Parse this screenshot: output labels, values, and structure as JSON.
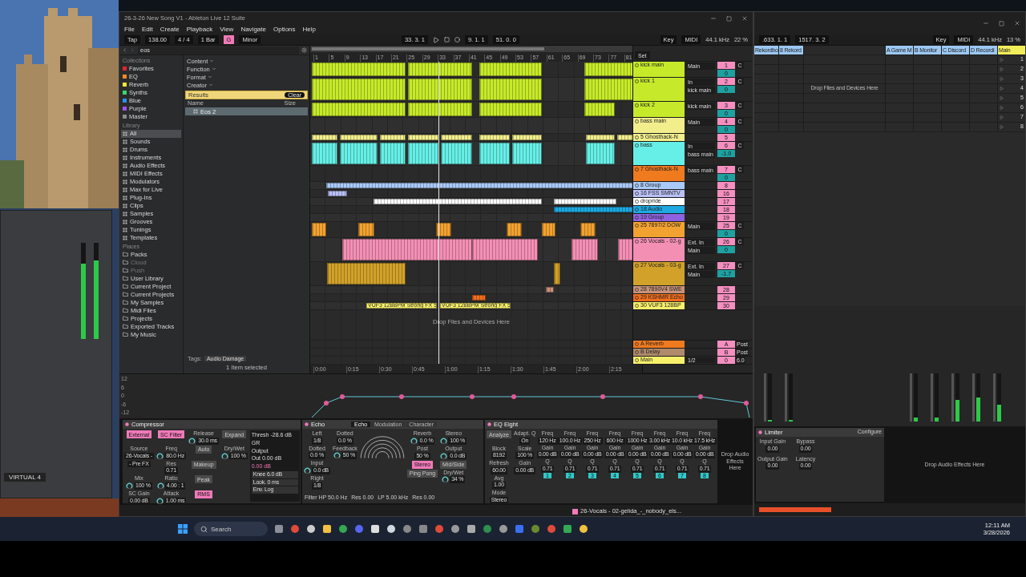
{
  "desktop": {
    "plugin_label": "VIRTUAL 4",
    "meters": [
      {
        "level": 0.78
      },
      {
        "level": 0.82
      }
    ]
  },
  "main_window": {
    "title": "26-3-26 New Song V1 - Ableton Live 12 Suite",
    "menu": [
      "File",
      "Edit",
      "Create",
      "Playback",
      "View",
      "Navigate",
      "Options",
      "Help"
    ],
    "control_bar": {
      "tap": "Tap",
      "tempo": "138.00",
      "signature": "4 / 4",
      "quantize": "1 Bar",
      "key": "G",
      "scale": "Minor",
      "position": "33. 3. 1",
      "loop_start": "9. 1. 1",
      "loop_length": "51. 0. 0",
      "key_button": "Key",
      "midi_button": "MIDI",
      "sample_rate": "44.1 kHz",
      "cpu": "22 %"
    },
    "browser": {
      "search": "eos",
      "collections_title": "Collections",
      "collections": [
        {
          "label": "Favorites",
          "color": "#e0252b"
        },
        {
          "label": "EQ",
          "color": "#f08a24"
        },
        {
          "label": "Reverb",
          "color": "#f2e634"
        },
        {
          "label": "Synths",
          "color": "#3ad66a"
        },
        {
          "label": "Blue",
          "color": "#2f8fe8"
        },
        {
          "label": "Purple",
          "color": "#a152e8"
        },
        {
          "label": "Master",
          "color": "#8a8a8a"
        }
      ],
      "library_title": "Library",
      "library": [
        {
          "label": "All",
          "selected": true
        },
        {
          "label": "Sounds",
          "selected": false
        },
        {
          "label": "Drums",
          "selected": false
        },
        {
          "label": "Instruments",
          "selected": false
        },
        {
          "label": "Audio Effects",
          "selected": false
        },
        {
          "label": "MIDI Effects",
          "selected": false
        },
        {
          "label": "Modulators",
          "selected": false
        },
        {
          "label": "Max for Live",
          "selected": false
        },
        {
          "label": "Plug-Ins",
          "selected": false
        },
        {
          "label": "Clips",
          "selected": false
        },
        {
          "label": "Samples",
          "selected": false
        },
        {
          "label": "Grooves",
          "selected": false
        },
        {
          "label": "Tunings",
          "selected": false
        },
        {
          "label": "Templates",
          "selected": false
        }
      ],
      "places_title": "Places",
      "places": [
        {
          "label": "Packs",
          "disabled": false
        },
        {
          "label": "Cloud",
          "disabled": true
        },
        {
          "label": "Push",
          "disabled": true
        },
        {
          "label": "User Library",
          "disabled": false
        },
        {
          "label": "Current Project",
          "disabled": false
        },
        {
          "label": "Current Projects",
          "disabled": false
        },
        {
          "label": "My Samples",
          "disabled": false
        },
        {
          "label": "Midi Files",
          "disabled": false
        },
        {
          "label": "Projects",
          "disabled": false
        },
        {
          "label": "Exported Tracks",
          "disabled": false
        },
        {
          "label": "My Music",
          "disabled": false
        }
      ],
      "filters": [
        "Content",
        "Function",
        "Format",
        "Creator"
      ],
      "results_label": "Results",
      "clear": "Clear",
      "columns": [
        "Name",
        "Size"
      ],
      "results": [
        {
          "name": "Eos 2",
          "selected": true
        }
      ],
      "tags_label": "Tags:",
      "tag": "Audio Damage",
      "status": "1 Item selected"
    },
    "arrangement": {
      "ruler": [
        "1",
        "5",
        "9",
        "13",
        "17",
        "21",
        "25",
        "29",
        "33",
        "37",
        "41",
        "45",
        "49",
        "53",
        "57",
        "61",
        "65",
        "69",
        "73",
        "77",
        "81"
      ],
      "set_button": "Set",
      "tracks": [
        {
          "number": "1",
          "name": "kick main",
          "color": "#c6ea2a",
          "expanded": true,
          "route": "Main",
          "volume": "0",
          "pan": "C"
        },
        {
          "number": "2",
          "name": "kick 1",
          "color": "#c6ea2a",
          "expanded": true,
          "input": "In",
          "route": "kick main",
          "volume": "0",
          "pan": "C"
        },
        {
          "number": "3",
          "name": "kick 2",
          "color": "#c6ea2a",
          "expanded": true,
          "route": "kick main",
          "volume": "0",
          "pan": "C"
        },
        {
          "number": "4",
          "name": "bass main",
          "color": "#f2ee8c",
          "expanded": true,
          "route": "Main",
          "volume": "0",
          "pan": "C"
        },
        {
          "number": "5",
          "name": "5 Ghosthack-N",
          "color": "#f2ee8c",
          "expanded": false
        },
        {
          "number": "6",
          "name": "bass",
          "color": "#66efe6",
          "expanded": true,
          "input": "In",
          "route": "bass main",
          "volume": "-1.0",
          "pan": "C"
        },
        {
          "number": "7",
          "name": "7 Ghosthack-N",
          "color": "#f07a1e",
          "expanded": true,
          "route": "bass main",
          "volume": "0",
          "pan": "C"
        },
        {
          "number": "8",
          "name": "8 Group",
          "color": "#a9c9f6",
          "expanded": false
        },
        {
          "number": "16",
          "name": "16 FSS  SMNTV",
          "color": "#b8bff5",
          "expanded": false
        },
        {
          "number": "17",
          "name": "dropride",
          "color": "#ffffff",
          "expanded": false
        },
        {
          "number": "18",
          "name": "18 Audio",
          "color": "#1ea9e1",
          "expanded": false
        },
        {
          "number": "19",
          "name": "19 Group",
          "color": "#8f62e0",
          "expanded": false
        },
        {
          "number": "25",
          "name": "25 7897/2 DOW",
          "color": "#f2a230",
          "expanded": true,
          "route": "Main",
          "volume": "0",
          "pan": "C"
        },
        {
          "number": "26",
          "name": "26 Vocals - 02-g",
          "color": "#f48fb4",
          "expanded": true,
          "input": "Ext. In",
          "route": "Main",
          "volume": "0",
          "pan": "C"
        },
        {
          "number": "27",
          "name": "27 Vocals - 03-g",
          "color": "#d1a12a",
          "expanded": true,
          "input": "Ext. In",
          "route": "Main",
          "volume": "-1.7",
          "pan": "C"
        },
        {
          "number": "28",
          "name": "28 7890V4 SWE",
          "color": "#c8927a",
          "expanded": false
        },
        {
          "number": "29",
          "name": "29 KSHMR Echo",
          "color": "#f06e1e",
          "expanded": false
        },
        {
          "number": "30",
          "name": "30 VUF3 128BP",
          "color": "#f7f06a",
          "expanded": false,
          "clip_labels": [
            "VUF3 128BPM Strong FX 5",
            "VUF3 128BPM Strong FX 5"
          ]
        }
      ],
      "drop_hint": "Drop Files and Devices Here",
      "returns": [
        {
          "number": "A",
          "name": "A Reverb",
          "color": "#f07a1e",
          "send": "Post"
        },
        {
          "number": "B",
          "name": "B Delay",
          "color": "#b08a6a",
          "send": "Post"
        },
        {
          "number": "0",
          "name": "Main",
          "color": "#f7f06a",
          "route": "1/2",
          "send": "6.0"
        }
      ],
      "time_ruler": [
        "0:00",
        "0:15",
        "0:30",
        "0:45",
        "1:00",
        "1:15",
        "1:30",
        "1:45",
        "2:00",
        "2:15"
      ]
    },
    "automation": {
      "scale": [
        "12",
        "6",
        "0",
        "-6",
        "-12"
      ]
    },
    "devices": [
      {
        "kind": "compressor",
        "name": "Compressor",
        "display": [
          "Thresh -28.6 dB",
          "GR",
          "Output",
          "Out 0.00 dB",
          "0.00 dB"
        ],
        "controls": [
          {
            "kind": "button",
            "label": "External",
            "on": true
          },
          {
            "kind": "field",
            "label": "Source",
            "value": "26-Vocals -"
          },
          {
            "kind": "field",
            "value": "- Pre FX"
          },
          {
            "kind": "knob",
            "label": "Mix",
            "value": "100 %"
          },
          {
            "kind": "field",
            "label": "SC Gain",
            "value": "0.00 dB"
          },
          {
            "kind": "button",
            "label": "SC Filter",
            "on": true
          },
          {
            "kind": "knob",
            "label": "Freq",
            "value": "80.0 Hz"
          },
          {
            "kind": "field",
            "label": "Res",
            "value": "0.71"
          },
          {
            "kind": "knob",
            "label": "Ratio",
            "value": "4.00 : 1"
          },
          {
            "kind": "knob",
            "label": "Attack",
            "value": "1.00 ms"
          },
          {
            "kind": "knob",
            "label": "Release",
            "value": "30.0 ms"
          },
          {
            "kind": "button",
            "label": "Auto",
            "on": false
          },
          {
            "kind": "button",
            "label": "Makeup",
            "on": false
          },
          {
            "kind": "button",
            "label": "Peak",
            "on": false
          },
          {
            "kind": "button",
            "label": "RMS",
            "on": true
          },
          {
            "kind": "button",
            "label": "Expand",
            "on": false
          },
          {
            "kind": "knob",
            "label": "Dry/Wet",
            "value": "100 %"
          }
        ],
        "footer": [
          "Knee 6.0 dB",
          "Look. 0 ms",
          "Env. Log"
        ]
      },
      {
        "kind": "echo",
        "name": "Echo",
        "tabs": [
          {
            "label": "Echo",
            "selected": true
          },
          {
            "label": "Modulation",
            "selected": false
          },
          {
            "label": "Character",
            "selected": false
          }
        ],
        "controls": [
          {
            "kind": "field",
            "label": "Left",
            "value": "1/8"
          },
          {
            "kind": "field",
            "label": "Dotted",
            "value": "0.0 %"
          },
          {
            "kind": "knob",
            "label": "Input",
            "value": "0.0 dB"
          },
          {
            "kind": "field",
            "label": "Right",
            "value": "1/8"
          },
          {
            "kind": "field",
            "label": "Dotted",
            "value": "0.0 %"
          },
          {
            "kind": "knob",
            "label": "Feedback",
            "value": "50 %"
          }
        ],
        "controls_right": [
          {
            "kind": "knob",
            "label": "Reverb",
            "value": "0.0 %"
          },
          {
            "kind": "field",
            "label": "Post",
            "value": "50 %"
          },
          {
            "kind": "button",
            "label": "Stereo",
            "on": true
          },
          {
            "kind": "button",
            "label": "Ping Pong",
            "on": false
          },
          {
            "kind": "knob",
            "label": "Stereo",
            "value": "100 %"
          },
          {
            "kind": "knob",
            "label": "Output",
            "value": "0.0 dB"
          },
          {
            "kind": "button",
            "label": "Mid/Side",
            "on": false
          },
          {
            "kind": "knob",
            "label": "Dry/Wet",
            "value": "34 %"
          }
        ],
        "footer": [
          "Filter HP 50.0 Hz",
          "Res 0.00",
          "LP 5.00 kHz",
          "Res 0.00"
        ]
      },
      {
        "kind": "eq",
        "name": "EQ Eight",
        "controls": [
          {
            "kind": "button",
            "label": "Analyze",
            "on": false
          },
          {
            "kind": "field",
            "label": "Block",
            "value": "8192"
          },
          {
            "kind": "field",
            "label": "Refresh",
            "value": "60.00"
          },
          {
            "kind": "field",
            "label": "Avg",
            "value": "1.00"
          }
        ],
        "bands": [
          {
            "freq_label": "Freq",
            "freq": "120 Hz",
            "gain_label": "Gain",
            "gain": "0.00 dB",
            "q_label": "Q",
            "q": "0.71",
            "number": "1"
          },
          {
            "freq_label": "Freq",
            "freq": "100.0 Hz",
            "gain_label": "Gain",
            "gain": "0.00 dB",
            "q_label": "Q",
            "q": "0.71",
            "number": "2"
          },
          {
            "freq_label": "Freq",
            "freq": "250 Hz",
            "gain_label": "Gain",
            "gain": "0.00 dB",
            "q_label": "Q",
            "q": "0.71",
            "number": "3"
          },
          {
            "freq_label": "Freq",
            "freq": "600 Hz",
            "gain_label": "Gain",
            "gain": "0.00 dB",
            "q_label": "Q",
            "q": "0.71",
            "number": "4"
          },
          {
            "freq_label": "Freq",
            "freq": "1000 Hz",
            "gain_label": "Gain",
            "gain": "0.00 dB",
            "q_label": "Q",
            "q": "0.71",
            "number": "5"
          },
          {
            "freq_label": "Freq",
            "freq": "3.00 kHz",
            "gain_label": "Gain",
            "gain": "0.00 dB",
            "q_label": "Q",
            "q": "0.71",
            "number": "6"
          },
          {
            "freq_label": "Freq",
            "freq": "10.0 kHz",
            "gain_label": "Gain",
            "gain": "0.00 dB",
            "q_label": "Q",
            "q": "0.71",
            "number": "7"
          },
          {
            "freq_label": "Freq",
            "freq": "17.5 kHz",
            "gain_label": "Gain",
            "gain": "0.00 dB",
            "q_label": "Q",
            "q": "0.71",
            "number": "8"
          }
        ],
        "controls_right": [
          {
            "kind": "field",
            "label": "Mode",
            "value": "Stereo"
          },
          {
            "kind": "field",
            "label": "Adapt. Q",
            "value": "On"
          },
          {
            "kind": "field",
            "label": "Scale",
            "value": "100 %"
          },
          {
            "kind": "field",
            "label": "Gain",
            "value": "0.00 dB"
          }
        ]
      }
    ],
    "drop_effects": "Drop Audio Effects Here",
    "status": {
      "clip_name": "26-Vocals - 02-gelida_-_nobody_els..."
    }
  },
  "session_window": {
    "toolbar": {
      "position": ".633. 1. 1",
      "loop": "1517. 3. 2",
      "key_button": "Key",
      "midi_button": "MIDI",
      "sample_rate": "44.1 kHz",
      "cpu": "13 %"
    },
    "tracks": [
      {
        "name": "Rekordbo",
        "color": "#9cc8f2"
      },
      {
        "name": "8 Rekord",
        "color": "#9cc8f2"
      }
    ],
    "drop_hint": "Drop Files and Devices Here",
    "returns": [
      {
        "name": "A Game M",
        "color": "#9cc8f2"
      },
      {
        "name": "B Monitor",
        "color": "#9cc8f2"
      },
      {
        "name": "C Discord",
        "color": "#9cc8f2"
      },
      {
        "name": "D Recordi",
        "color": "#9cc8f2"
      }
    ],
    "main": {
      "name": "Main",
      "color": "#f2ee5a"
    },
    "scenes": [
      "1",
      "2",
      "3",
      "4",
      "5",
      "6",
      "7",
      "8"
    ],
    "meters": [
      {
        "level": 0.04
      },
      {
        "level": 0.04
      },
      {
        "level": 0.08
      },
      {
        "level": 0.08
      },
      {
        "level": 0.45
      },
      {
        "level": 0.5
      },
      {
        "level": 0.35
      }
    ],
    "limiter": {
      "name": "Limiter",
      "configure": "Configure",
      "controls": [
        {
          "label": "Input Gain",
          "value": "0.00"
        },
        {
          "label": "Output Gain",
          "value": "0.00"
        },
        {
          "label": "Bypass",
          "value": "0.00"
        },
        {
          "label": "Latency",
          "value": "0.00"
        }
      ]
    },
    "drop_effects": "Drop Audio Effects Here"
  },
  "taskbar": {
    "search": "Search",
    "time": "12:11 AM",
    "date": "3/28/2026"
  }
}
